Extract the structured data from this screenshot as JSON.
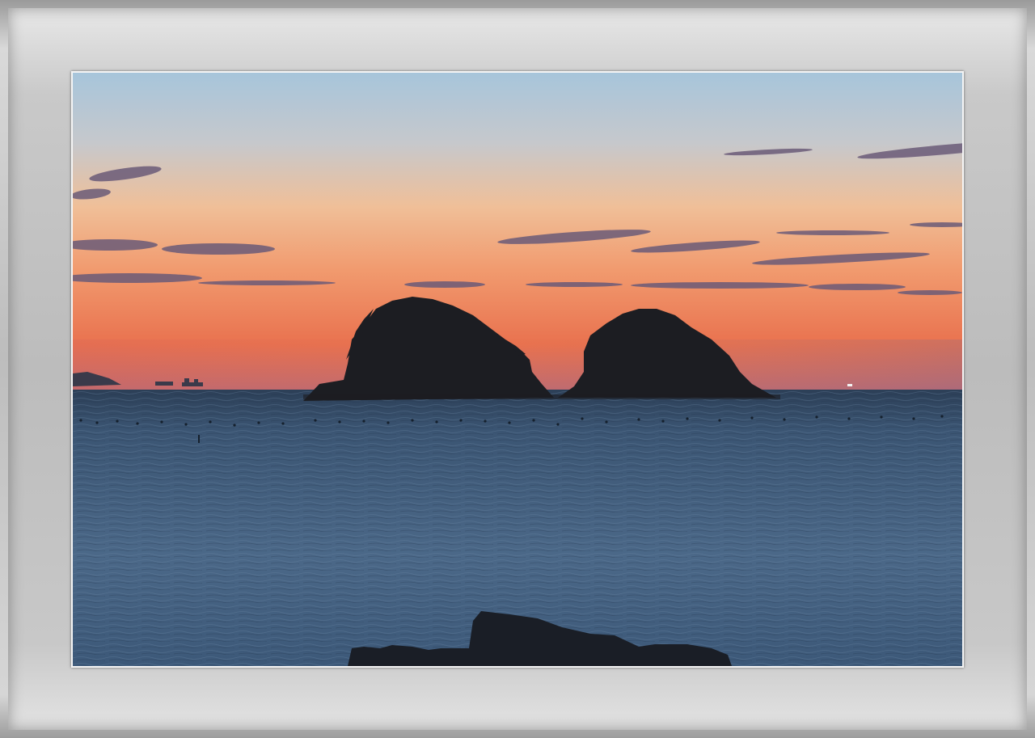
{
  "image": {
    "subject": "sunset-over-sea-with-two-islands",
    "colors": {
      "sky_top": "#a9c6dc",
      "sky_mid": "#f2b28a",
      "sky_horizon": "#e8704e",
      "sea": "#3e5a78",
      "silhouette": "#1a1c22",
      "frame": "#bfbfbf"
    }
  }
}
